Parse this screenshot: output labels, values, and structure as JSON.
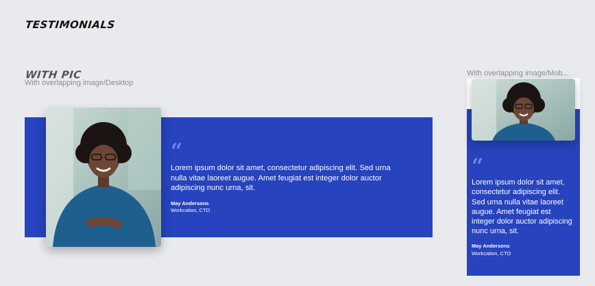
{
  "page": {
    "title": "TESTIMONIALS",
    "section_title": "WITH PIC"
  },
  "desktop": {
    "frame_label": "With overlapping image/Desktop",
    "quote_mark": "“",
    "quote": "Lorem ipsum dolor sit amet, consectetur adipiscing elit. Sed urna nulla vitae laoreet augue. Amet feugiat est integer dolor auctor adipiscing nunc urna, sit.",
    "author_name": "May Andersons",
    "author_role": "Workcation, CTO"
  },
  "mobile": {
    "frame_label": "With overlapping image/Mob...",
    "quote_mark": "“",
    "quote": "Lorem ipsum dolor sit amet, consectetur adipiscing elit. Sed urna nulla vitae laoreet augue. Amet feugiat est integer dolor auctor adipiscing nunc urna, sit.",
    "author_name": "May Andersons",
    "author_role": "Workcation, CTO"
  },
  "colors": {
    "background": "#e9eaee",
    "band": "#2743bd",
    "quote_mark": "#6f86e0",
    "text": "#ffffff"
  }
}
